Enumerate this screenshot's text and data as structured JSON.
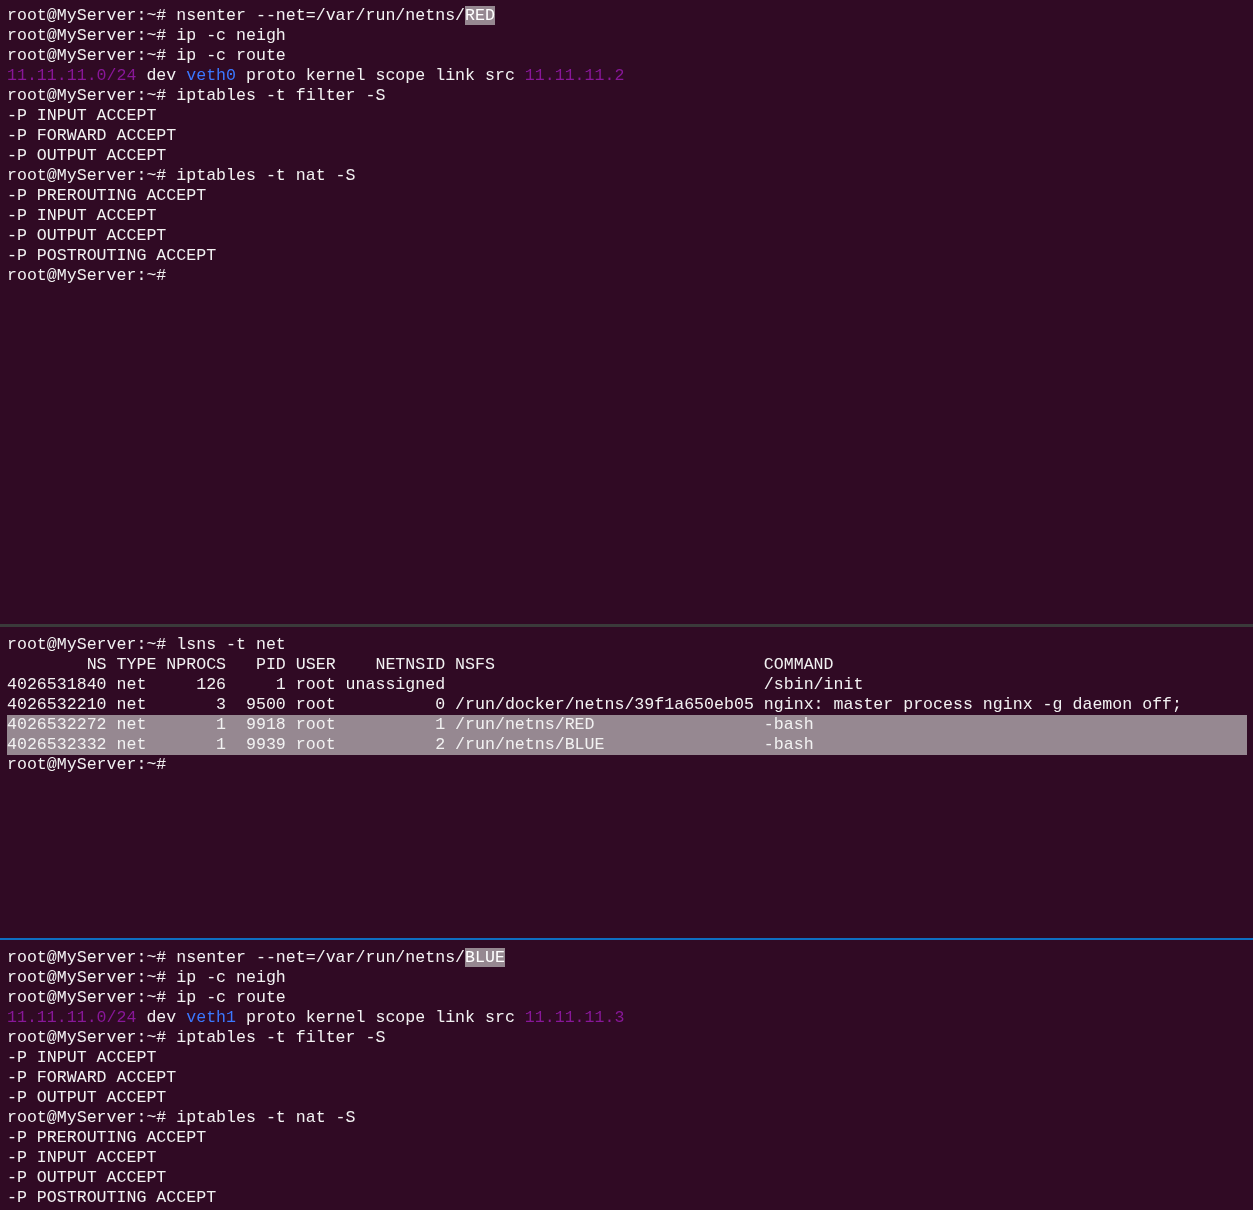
{
  "panes": [
    {
      "focused": false,
      "lines": [
        {
          "segments": [
            {
              "kind": "plain",
              "text": "root@MyServer:~# nsenter --net=/var/run/netns/"
            },
            {
              "kind": "selection",
              "text": "RED"
            }
          ]
        },
        {
          "segments": [
            {
              "kind": "plain",
              "text": "root@MyServer:~# ip -c neigh"
            }
          ]
        },
        {
          "segments": [
            {
              "kind": "plain",
              "text": "root@MyServer:~# ip -c route"
            }
          ]
        },
        {
          "segments": [
            {
              "kind": "address",
              "text": "11.11.11.0/24"
            },
            {
              "kind": "plain",
              "text": " dev "
            },
            {
              "kind": "device",
              "text": "veth0"
            },
            {
              "kind": "plain",
              "text": " proto kernel scope link src "
            },
            {
              "kind": "address",
              "text": "11.11.11.2"
            }
          ]
        },
        {
          "segments": [
            {
              "kind": "plain",
              "text": "root@MyServer:~# iptables -t filter -S"
            }
          ]
        },
        {
          "segments": [
            {
              "kind": "plain",
              "text": "-P INPUT ACCEPT"
            }
          ]
        },
        {
          "segments": [
            {
              "kind": "plain",
              "text": "-P FORWARD ACCEPT"
            }
          ]
        },
        {
          "segments": [
            {
              "kind": "plain",
              "text": "-P OUTPUT ACCEPT"
            }
          ]
        },
        {
          "segments": [
            {
              "kind": "plain",
              "text": "root@MyServer:~# iptables -t nat -S"
            }
          ]
        },
        {
          "segments": [
            {
              "kind": "plain",
              "text": "-P PREROUTING ACCEPT"
            }
          ]
        },
        {
          "segments": [
            {
              "kind": "plain",
              "text": "-P INPUT ACCEPT"
            }
          ]
        },
        {
          "segments": [
            {
              "kind": "plain",
              "text": "-P OUTPUT ACCEPT"
            }
          ]
        },
        {
          "segments": [
            {
              "kind": "plain",
              "text": "-P POSTROUTING ACCEPT"
            }
          ]
        },
        {
          "segments": [
            {
              "kind": "plain",
              "text": "root@MyServer:~#"
            }
          ]
        }
      ]
    },
    {
      "focused": false,
      "lines": [
        {
          "selected": false,
          "segments": [
            {
              "kind": "plain",
              "text": "root@MyServer:~# lsns -t net"
            }
          ]
        },
        {
          "selected": false,
          "segments": [
            {
              "kind": "plain",
              "text": "        NS TYPE NPROCS   PID USER    NETNSID NSFS                           COMMAND"
            }
          ]
        },
        {
          "selected": false,
          "segments": [
            {
              "kind": "plain",
              "text": "4026531840 net     126     1 root unassigned                                /sbin/init"
            }
          ]
        },
        {
          "selected": false,
          "segments": [
            {
              "kind": "plain",
              "text": "4026532210 net       3  9500 root          0 /run/docker/netns/39f1a650eb05 nginx: master process nginx -g daemon off;"
            }
          ]
        },
        {
          "selected": true,
          "segments": [
            {
              "kind": "plain",
              "text": "4026532272 net       1  9918 root          1 /run/netns/RED                 -bash"
            }
          ]
        },
        {
          "selected": true,
          "segments": [
            {
              "kind": "plain",
              "text": "4026532332 net       1  9939 root          2 /run/netns/BLUE                -bash"
            }
          ]
        },
        {
          "selected": false,
          "segments": [
            {
              "kind": "plain",
              "text": "root@MyServer:~#"
            }
          ]
        }
      ]
    },
    {
      "focused": true,
      "lines": [
        {
          "segments": [
            {
              "kind": "plain",
              "text": "root@MyServer:~# nsenter --net=/var/run/netns/"
            },
            {
              "kind": "selection",
              "text": "BLUE"
            }
          ]
        },
        {
          "segments": [
            {
              "kind": "plain",
              "text": "root@MyServer:~# ip -c neigh"
            }
          ]
        },
        {
          "segments": [
            {
              "kind": "plain",
              "text": "root@MyServer:~# ip -c route"
            }
          ]
        },
        {
          "segments": [
            {
              "kind": "address",
              "text": "11.11.11.0/24"
            },
            {
              "kind": "plain",
              "text": " dev "
            },
            {
              "kind": "device",
              "text": "veth1"
            },
            {
              "kind": "plain",
              "text": " proto kernel scope link src "
            },
            {
              "kind": "address",
              "text": "11.11.11.3"
            }
          ]
        },
        {
          "segments": [
            {
              "kind": "plain",
              "text": "root@MyServer:~# iptables -t filter -S"
            }
          ]
        },
        {
          "segments": [
            {
              "kind": "plain",
              "text": "-P INPUT ACCEPT"
            }
          ]
        },
        {
          "segments": [
            {
              "kind": "plain",
              "text": "-P FORWARD ACCEPT"
            }
          ]
        },
        {
          "segments": [
            {
              "kind": "plain",
              "text": "-P OUTPUT ACCEPT"
            }
          ]
        },
        {
          "segments": [
            {
              "kind": "plain",
              "text": "root@MyServer:~# iptables -t nat -S"
            }
          ]
        },
        {
          "segments": [
            {
              "kind": "plain",
              "text": "-P PREROUTING ACCEPT"
            }
          ]
        },
        {
          "segments": [
            {
              "kind": "plain",
              "text": "-P INPUT ACCEPT"
            }
          ]
        },
        {
          "segments": [
            {
              "kind": "plain",
              "text": "-P OUTPUT ACCEPT"
            }
          ]
        },
        {
          "segments": [
            {
              "kind": "plain",
              "text": "-P POSTROUTING ACCEPT"
            }
          ]
        }
      ]
    }
  ]
}
